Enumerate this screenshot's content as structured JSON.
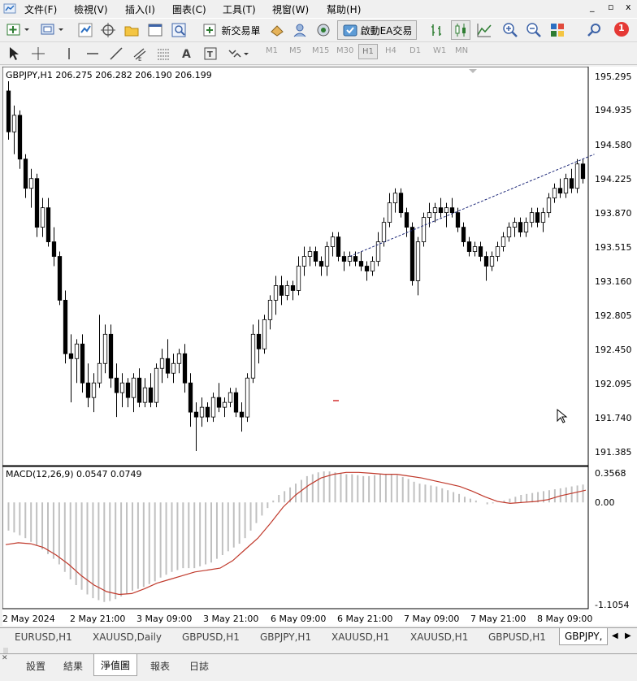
{
  "menu": [
    "文件(F)",
    "檢視(V)",
    "插入(I)",
    "圖表(C)",
    "工具(T)",
    "視窗(W)",
    "幫助(H)"
  ],
  "window_controls": [
    "_",
    "▫",
    "x"
  ],
  "toolbar": {
    "new_order": "新交易單",
    "autotrading": "啟動EA交易",
    "notification_count": "1"
  },
  "timeframes": [
    "M1",
    "M5",
    "M15",
    "M30",
    "H1",
    "H4",
    "D1",
    "W1",
    "MN"
  ],
  "active_timeframe": "H1",
  "chart": {
    "header": "GBPJPY,H1  206.275 206.282 206.190 206.199",
    "price_ticks": [
      "195.295",
      "194.935",
      "194.580",
      "194.225",
      "193.870",
      "193.515",
      "193.160",
      "192.805",
      "192.450",
      "192.095",
      "191.740",
      "191.385"
    ],
    "macd_label": "MACD(12,26,9) 0.0547 0.0749",
    "macd_ticks": [
      "0.3568",
      "0.00",
      "-1.1054"
    ],
    "time_ticks": [
      "2 May 2024",
      "2 May 21:00",
      "3 May 09:00",
      "3 May 21:00",
      "6 May 09:00",
      "6 May 21:00",
      "7 May 09:00",
      "7 May 21:00",
      "8 May 09:00"
    ]
  },
  "chart_tabs": [
    "EURUSD,H1",
    "XAUUSD,Daily",
    "GBPUSD,H1",
    "GBPJPY,H1",
    "XAUUSD,H1",
    "XAUUSD,H1",
    "GBPUSD,H1",
    "GBPJPY,"
  ],
  "active_chart_tab": "GBPJPY,",
  "bottom_tabs": [
    "設置",
    "結果",
    "淨值圖",
    "報表",
    "日誌"
  ],
  "active_bottom_tab": "淨值圖",
  "colors": {
    "bull_candle": "#ffffff",
    "bear_candle": "#000000",
    "signal_line": "#c0392b",
    "histogram": "#c0c0c0",
    "trendline": "#1f2a7a"
  },
  "chart_data": {
    "type": "candlestick",
    "symbol": "GBPJPY",
    "timeframe": "H1",
    "ylim": [
      191.25,
      195.35
    ],
    "candles": [
      {
        "o": 195.1,
        "h": 195.2,
        "l": 194.6,
        "c": 194.68
      },
      {
        "o": 194.68,
        "h": 194.95,
        "l": 194.45,
        "c": 194.85
      },
      {
        "o": 194.85,
        "h": 194.9,
        "l": 194.3,
        "c": 194.4
      },
      {
        "o": 194.4,
        "h": 194.45,
        "l": 194.0,
        "c": 194.1
      },
      {
        "o": 194.1,
        "h": 194.3,
        "l": 193.9,
        "c": 194.2
      },
      {
        "o": 194.2,
        "h": 194.25,
        "l": 193.6,
        "c": 193.7
      },
      {
        "o": 193.7,
        "h": 194.0,
        "l": 193.6,
        "c": 193.9
      },
      {
        "o": 193.9,
        "h": 194.0,
        "l": 193.5,
        "c": 193.55
      },
      {
        "o": 193.55,
        "h": 193.7,
        "l": 193.3,
        "c": 193.4
      },
      {
        "o": 193.4,
        "h": 193.45,
        "l": 192.9,
        "c": 192.95
      },
      {
        "o": 192.95,
        "h": 193.05,
        "l": 192.3,
        "c": 192.4
      },
      {
        "o": 192.4,
        "h": 192.6,
        "l": 191.9,
        "c": 192.35
      },
      {
        "o": 192.35,
        "h": 192.55,
        "l": 192.1,
        "c": 192.5
      },
      {
        "o": 192.5,
        "h": 192.6,
        "l": 192.0,
        "c": 192.1
      },
      {
        "o": 192.1,
        "h": 192.3,
        "l": 191.85,
        "c": 191.95
      },
      {
        "o": 191.95,
        "h": 192.2,
        "l": 191.8,
        "c": 192.1
      },
      {
        "o": 192.1,
        "h": 192.8,
        "l": 192.05,
        "c": 192.3
      },
      {
        "o": 192.3,
        "h": 192.7,
        "l": 192.2,
        "c": 192.6
      },
      {
        "o": 192.6,
        "h": 192.7,
        "l": 192.05,
        "c": 192.15
      },
      {
        "o": 192.15,
        "h": 192.3,
        "l": 191.75,
        "c": 192.0
      },
      {
        "o": 192.0,
        "h": 192.2,
        "l": 191.85,
        "c": 192.1
      },
      {
        "o": 192.1,
        "h": 192.15,
        "l": 191.85,
        "c": 191.95
      },
      {
        "o": 191.95,
        "h": 192.2,
        "l": 191.8,
        "c": 192.15
      },
      {
        "o": 192.15,
        "h": 192.25,
        "l": 191.85,
        "c": 191.9
      },
      {
        "o": 191.9,
        "h": 192.15,
        "l": 191.85,
        "c": 192.05
      },
      {
        "o": 192.05,
        "h": 192.2,
        "l": 191.85,
        "c": 191.9
      },
      {
        "o": 191.9,
        "h": 192.3,
        "l": 191.85,
        "c": 192.25
      },
      {
        "o": 192.25,
        "h": 192.45,
        "l": 192.1,
        "c": 192.35
      },
      {
        "o": 192.35,
        "h": 192.55,
        "l": 192.15,
        "c": 192.2
      },
      {
        "o": 192.2,
        "h": 192.4,
        "l": 192.1,
        "c": 192.3
      },
      {
        "o": 192.3,
        "h": 192.45,
        "l": 192.2,
        "c": 192.4
      },
      {
        "o": 192.4,
        "h": 192.5,
        "l": 192.0,
        "c": 192.1
      },
      {
        "o": 192.1,
        "h": 192.2,
        "l": 191.65,
        "c": 191.8
      },
      {
        "o": 191.8,
        "h": 191.9,
        "l": 191.4,
        "c": 191.75
      },
      {
        "o": 191.75,
        "h": 191.95,
        "l": 191.65,
        "c": 191.85
      },
      {
        "o": 191.85,
        "h": 191.9,
        "l": 191.7,
        "c": 191.75
      },
      {
        "o": 191.75,
        "h": 192.0,
        "l": 191.7,
        "c": 191.95
      },
      {
        "o": 191.95,
        "h": 192.1,
        "l": 191.8,
        "c": 191.85
      },
      {
        "o": 191.85,
        "h": 191.95,
        "l": 191.75,
        "c": 191.9
      },
      {
        "o": 191.9,
        "h": 192.05,
        "l": 191.85,
        "c": 192.0
      },
      {
        "o": 192.0,
        "h": 192.05,
        "l": 191.75,
        "c": 191.8
      },
      {
        "o": 191.8,
        "h": 191.9,
        "l": 191.6,
        "c": 191.75
      },
      {
        "o": 191.75,
        "h": 192.2,
        "l": 191.7,
        "c": 192.15
      },
      {
        "o": 192.15,
        "h": 192.7,
        "l": 192.1,
        "c": 192.6
      },
      {
        "o": 192.6,
        "h": 192.75,
        "l": 192.3,
        "c": 192.45
      },
      {
        "o": 192.45,
        "h": 192.8,
        "l": 192.4,
        "c": 192.75
      },
      {
        "o": 192.75,
        "h": 193.0,
        "l": 192.65,
        "c": 192.95
      },
      {
        "o": 192.95,
        "h": 193.2,
        "l": 192.8,
        "c": 193.1
      },
      {
        "o": 193.1,
        "h": 193.2,
        "l": 192.9,
        "c": 193.0
      },
      {
        "o": 193.0,
        "h": 193.15,
        "l": 192.95,
        "c": 193.1
      },
      {
        "o": 193.1,
        "h": 193.15,
        "l": 192.95,
        "c": 193.05
      },
      {
        "o": 193.05,
        "h": 193.4,
        "l": 193.0,
        "c": 193.3
      },
      {
        "o": 193.3,
        "h": 193.5,
        "l": 193.2,
        "c": 193.4
      },
      {
        "o": 193.4,
        "h": 193.5,
        "l": 193.3,
        "c": 193.45
      },
      {
        "o": 193.45,
        "h": 193.5,
        "l": 193.3,
        "c": 193.35
      },
      {
        "o": 193.35,
        "h": 193.4,
        "l": 193.2,
        "c": 193.3
      },
      {
        "o": 193.3,
        "h": 193.55,
        "l": 193.2,
        "c": 193.5
      },
      {
        "o": 193.5,
        "h": 193.65,
        "l": 193.4,
        "c": 193.6
      },
      {
        "o": 193.6,
        "h": 193.65,
        "l": 193.35,
        "c": 193.4
      },
      {
        "o": 193.4,
        "h": 193.45,
        "l": 193.25,
        "c": 193.35
      },
      {
        "o": 193.35,
        "h": 193.45,
        "l": 193.3,
        "c": 193.4
      },
      {
        "o": 193.4,
        "h": 193.45,
        "l": 193.3,
        "c": 193.35
      },
      {
        "o": 193.35,
        "h": 193.45,
        "l": 193.25,
        "c": 193.3
      },
      {
        "o": 193.3,
        "h": 193.35,
        "l": 193.15,
        "c": 193.25
      },
      {
        "o": 193.25,
        "h": 193.4,
        "l": 193.2,
        "c": 193.35
      },
      {
        "o": 193.35,
        "h": 193.65,
        "l": 193.3,
        "c": 193.55
      },
      {
        "o": 193.55,
        "h": 193.8,
        "l": 193.5,
        "c": 193.75
      },
      {
        "o": 193.75,
        "h": 194.05,
        "l": 193.7,
        "c": 193.95
      },
      {
        "o": 193.95,
        "h": 194.1,
        "l": 193.85,
        "c": 194.05
      },
      {
        "o": 194.05,
        "h": 194.1,
        "l": 193.8,
        "c": 193.85
      },
      {
        "o": 193.85,
        "h": 193.9,
        "l": 193.6,
        "c": 193.7
      },
      {
        "o": 193.7,
        "h": 193.75,
        "l": 193.1,
        "c": 193.15
      },
      {
        "o": 193.15,
        "h": 193.6,
        "l": 193.0,
        "c": 193.55
      },
      {
        "o": 193.55,
        "h": 193.85,
        "l": 193.5,
        "c": 193.8
      },
      {
        "o": 193.8,
        "h": 193.95,
        "l": 193.7,
        "c": 193.85
      },
      {
        "o": 193.85,
        "h": 193.95,
        "l": 193.75,
        "c": 193.9
      },
      {
        "o": 193.9,
        "h": 194.0,
        "l": 193.8,
        "c": 193.85
      },
      {
        "o": 193.85,
        "h": 193.95,
        "l": 193.7,
        "c": 193.9
      },
      {
        "o": 193.9,
        "h": 194.0,
        "l": 193.8,
        "c": 193.85
      },
      {
        "o": 193.85,
        "h": 193.9,
        "l": 193.65,
        "c": 193.7
      },
      {
        "o": 193.7,
        "h": 193.75,
        "l": 193.5,
        "c": 193.55
      },
      {
        "o": 193.55,
        "h": 193.6,
        "l": 193.4,
        "c": 193.45
      },
      {
        "o": 193.45,
        "h": 193.55,
        "l": 193.4,
        "c": 193.5
      },
      {
        "o": 193.5,
        "h": 193.55,
        "l": 193.35,
        "c": 193.4
      },
      {
        "o": 193.4,
        "h": 193.45,
        "l": 193.15,
        "c": 193.3
      },
      {
        "o": 193.3,
        "h": 193.45,
        "l": 193.25,
        "c": 193.4
      },
      {
        "o": 193.4,
        "h": 193.55,
        "l": 193.35,
        "c": 193.5
      },
      {
        "o": 193.5,
        "h": 193.65,
        "l": 193.45,
        "c": 193.6
      },
      {
        "o": 193.6,
        "h": 193.75,
        "l": 193.55,
        "c": 193.7
      },
      {
        "o": 193.7,
        "h": 193.8,
        "l": 193.6,
        "c": 193.75
      },
      {
        "o": 193.75,
        "h": 193.8,
        "l": 193.6,
        "c": 193.65
      },
      {
        "o": 193.65,
        "h": 193.8,
        "l": 193.6,
        "c": 193.75
      },
      {
        "o": 193.75,
        "h": 193.9,
        "l": 193.7,
        "c": 193.85
      },
      {
        "o": 193.85,
        "h": 193.9,
        "l": 193.7,
        "c": 193.75
      },
      {
        "o": 193.75,
        "h": 193.9,
        "l": 193.65,
        "c": 193.85
      },
      {
        "o": 193.85,
        "h": 194.05,
        "l": 193.8,
        "c": 194.0
      },
      {
        "o": 194.0,
        "h": 194.15,
        "l": 193.95,
        "c": 194.1
      },
      {
        "o": 194.1,
        "h": 194.2,
        "l": 194.0,
        "c": 194.05
      },
      {
        "o": 194.05,
        "h": 194.25,
        "l": 194.0,
        "c": 194.2
      },
      {
        "o": 194.2,
        "h": 194.3,
        "l": 194.05,
        "c": 194.1
      },
      {
        "o": 194.1,
        "h": 194.4,
        "l": 194.05,
        "c": 194.35
      },
      {
        "o": 194.35,
        "h": 194.4,
        "l": 194.15,
        "c": 194.2
      }
    ],
    "trendline": {
      "style": "dashed",
      "from": [
        60,
        193.4
      ],
      "to": [
        103,
        194.45
      ]
    },
    "macd": {
      "ylim": [
        -1.1054,
        0.3568
      ],
      "histogram": [
        -0.3,
        -0.32,
        -0.35,
        -0.38,
        -0.42,
        -0.46,
        -0.5,
        -0.55,
        -0.6,
        -0.66,
        -0.74,
        -0.82,
        -0.88,
        -0.93,
        -0.98,
        -1.02,
        -1.04,
        -1.06,
        -1.05,
        -1.03,
        -1.0,
        -0.97,
        -0.94,
        -0.92,
        -0.9,
        -0.87,
        -0.84,
        -0.8,
        -0.77,
        -0.74,
        -0.72,
        -0.7,
        -0.7,
        -0.7,
        -0.68,
        -0.66,
        -0.64,
        -0.6,
        -0.56,
        -0.52,
        -0.48,
        -0.44,
        -0.38,
        -0.3,
        -0.22,
        -0.14,
        -0.06,
        0.02,
        0.08,
        0.12,
        0.16,
        0.2,
        0.24,
        0.28,
        0.3,
        0.32,
        0.33,
        0.33,
        0.32,
        0.31,
        0.3,
        0.3,
        0.29,
        0.28,
        0.28,
        0.29,
        0.3,
        0.3,
        0.3,
        0.29,
        0.27,
        0.25,
        0.22,
        0.2,
        0.19,
        0.18,
        0.17,
        0.15,
        0.13,
        0.11,
        0.09,
        0.06,
        0.04,
        0.02,
        0.0,
        -0.02,
        -0.01,
        0.0,
        0.02,
        0.04,
        0.06,
        0.08,
        0.09,
        0.1,
        0.11,
        0.12,
        0.13,
        0.14,
        0.15,
        0.16,
        0.17,
        0.18,
        0.19
      ],
      "signal": [
        -0.45,
        -0.43,
        -0.44,
        -0.48,
        -0.56,
        -0.66,
        -0.78,
        -0.88,
        -0.95,
        -0.98,
        -0.97,
        -0.92,
        -0.86,
        -0.82,
        -0.78,
        -0.74,
        -0.72,
        -0.7,
        -0.62,
        -0.5,
        -0.38,
        -0.22,
        -0.05,
        0.08,
        0.18,
        0.26,
        0.3,
        0.32,
        0.32,
        0.31,
        0.3,
        0.3,
        0.28,
        0.26,
        0.23,
        0.2,
        0.17,
        0.12,
        0.06,
        0.01,
        -0.01,
        0.0,
        0.01,
        0.03,
        0.07,
        0.1,
        0.13
      ]
    }
  }
}
